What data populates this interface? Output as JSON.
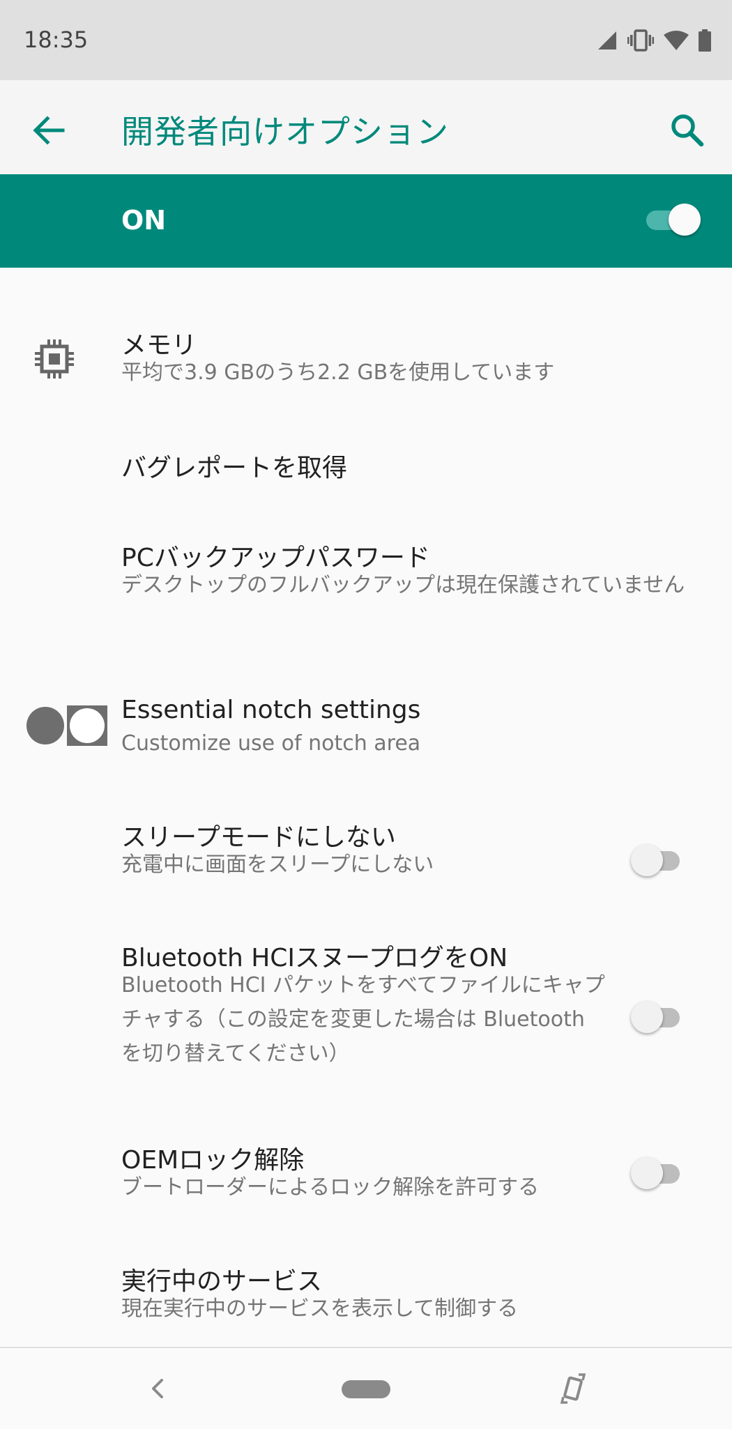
{
  "status_bar": {
    "time": "18:35",
    "icons": [
      "cell-signal-icon",
      "vibrate-icon",
      "wifi-icon",
      "battery-icon"
    ]
  },
  "app_bar": {
    "title": "開発者向けオプション",
    "back_icon": "arrow-back-icon",
    "search_icon": "search-icon"
  },
  "master_switch": {
    "label": "ON",
    "checked": true
  },
  "items": [
    {
      "title": "メモリ",
      "summary": "平均で3.9 GBのうち2.2 GBを使用しています",
      "icon": "memory-chip-icon"
    },
    {
      "title": "バグレポートを取得"
    },
    {
      "title": "PCバックアップパスワード",
      "summary": "デスクトップのフルバックアップは現在保護されていません"
    },
    {
      "title": "Essential notch settings",
      "summary": "Customize use of notch area",
      "icon": "notch-icon"
    },
    {
      "title": "スリープモードにしない",
      "summary": "充電中に画面をスリープにしない",
      "switch": false
    },
    {
      "title": "Bluetooth HCIスヌープログをON",
      "summary": "Bluetooth HCI パケットをすべてファイルにキャプチャする（この設定を変更した場合は Bluetooth を切り替えてください）",
      "switch": false
    },
    {
      "title": "OEMロック解除",
      "summary": "ブートローダーによるロック解除を許可する",
      "switch": false
    },
    {
      "title": "実行中のサービス",
      "summary": "現在実行中のサービスを表示して制御する"
    }
  ],
  "nav_bar": {
    "icons": [
      "nav-back-icon",
      "nav-home-pill-icon",
      "rotate-screen-icon"
    ]
  },
  "colors": {
    "accent": "#00897b",
    "switch_track_on": "#4db6ac",
    "text_primary": "#212121",
    "text_secondary": "#757575"
  }
}
